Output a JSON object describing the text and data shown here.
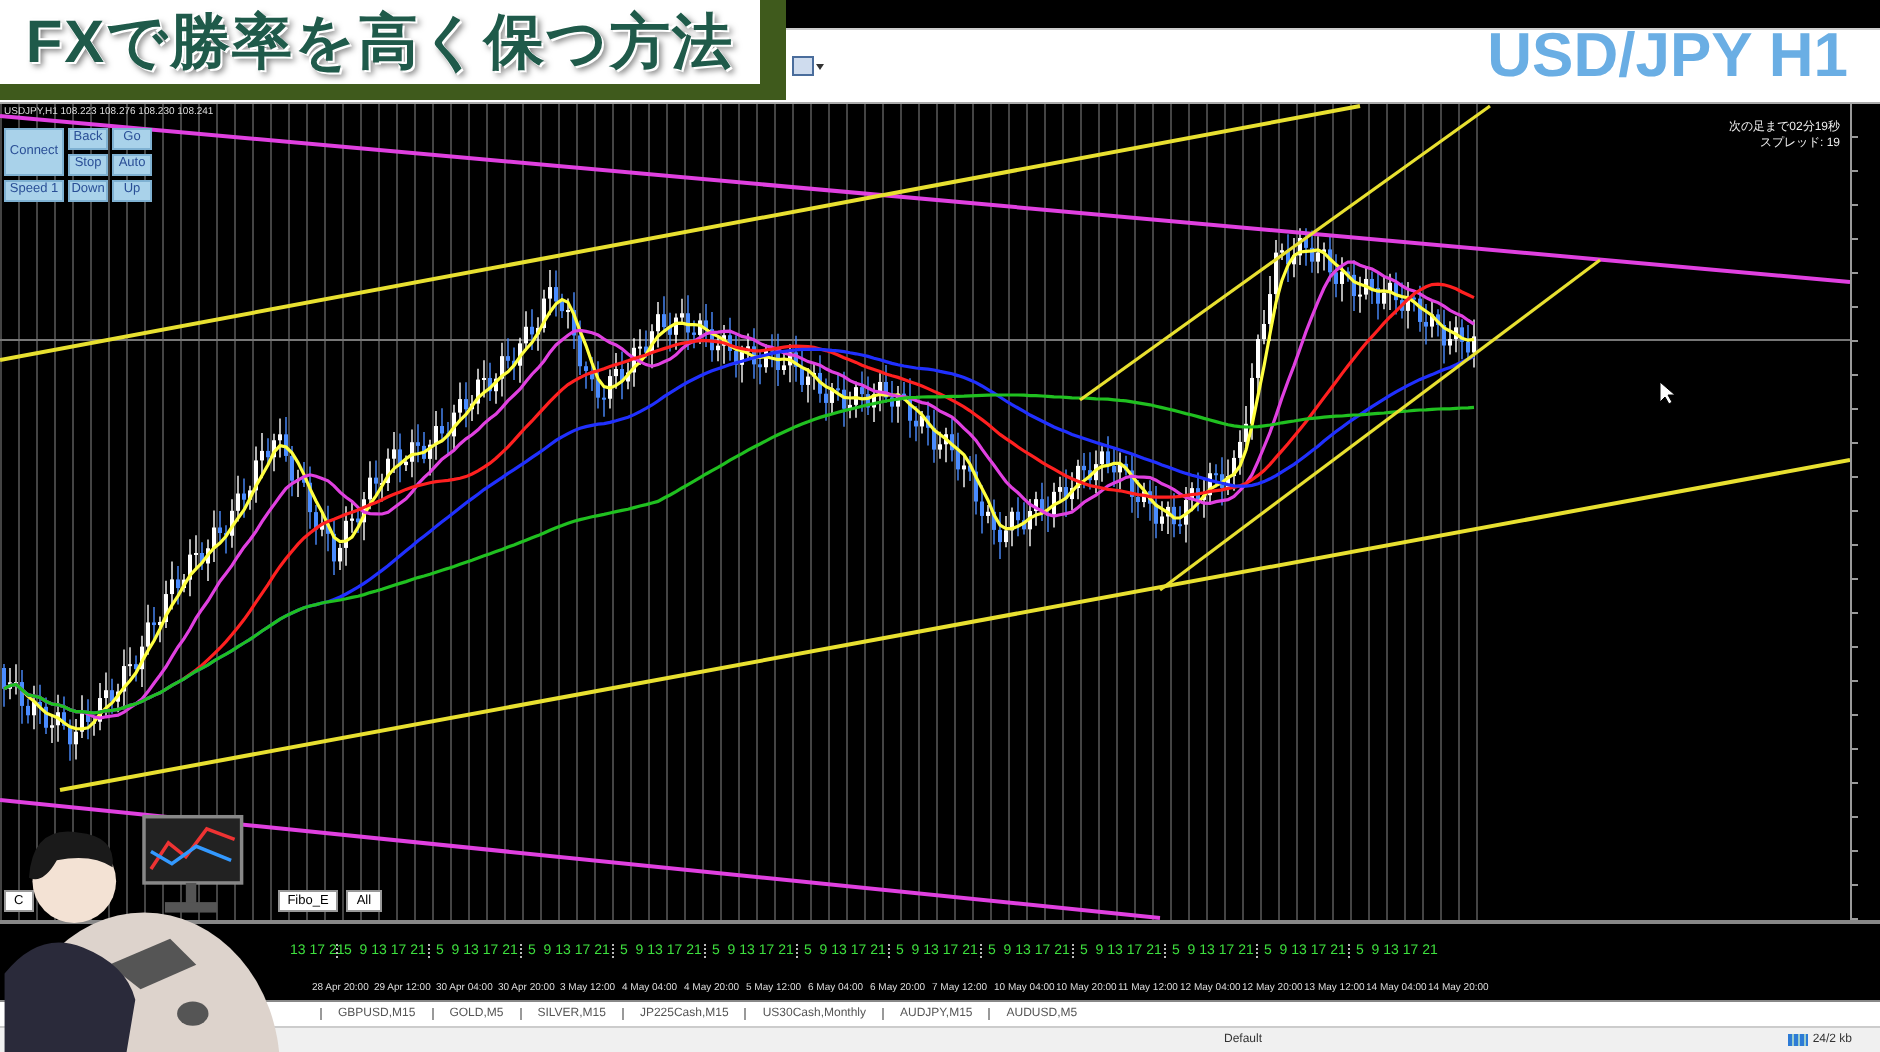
{
  "video_title": "FXで勝率を高く保つ方法",
  "symbol_title": "USD/JPY H1",
  "chart": {
    "header": "USDJPY,H1  108.223 108.276 108.230 108.241",
    "controls": [
      {
        "label": "Connect"
      },
      {
        "label": "Back"
      },
      {
        "label": "Go"
      },
      {
        "label": "Stop"
      },
      {
        "label": "Auto"
      },
      {
        "label": "Speed 1"
      },
      {
        "label": "Down"
      },
      {
        "label": "Up"
      }
    ],
    "info_lines": [
      "次の足まで02分19秒",
      "スプレッド: 19"
    ],
    "chart_buttons": [
      "C",
      "Fibo_E",
      "All"
    ]
  },
  "hour_labels": [
    "13 17 21",
    "5  9 13 17 21",
    "5  9 13 17 21",
    "5  9 13 17 21",
    "5  9 13 17 21",
    "5  9 13 17 21",
    "5  9 13 17 21",
    "5  9 13 17 21",
    "5  9 13 17 21",
    "5  9 13 17 21",
    "5  9 13 17 21",
    "5  9 13 17 21",
    "5  9 13 17 21"
  ],
  "date_labels": [
    "28 Apr 20:00",
    "29 Apr 12:00",
    "30 Apr 04:00",
    "30 Apr 20:00",
    "3 May 12:00",
    "4 May 04:00",
    "4 May 20:00",
    "5 May 12:00",
    "6 May 04:00",
    "6 May 20:00",
    "7 May 12:00",
    "10 May 04:00",
    "10 May 20:00",
    "11 May 12:00",
    "12 May 04:00",
    "12 May 20:00",
    "13 May 12:00",
    "14 May 04:00",
    "14 May 20:00"
  ],
  "symbol_tabs": [
    "GBPUSD,M15",
    "GOLD,M5",
    "SILVER,M15",
    "JP225Cash,M15",
    "US30Cash,Monthly",
    "AUDJPY,M15",
    "AUDUSD,M5"
  ],
  "status_bar": {
    "profile": "Default",
    "traffic": "24/2 kb"
  }
}
